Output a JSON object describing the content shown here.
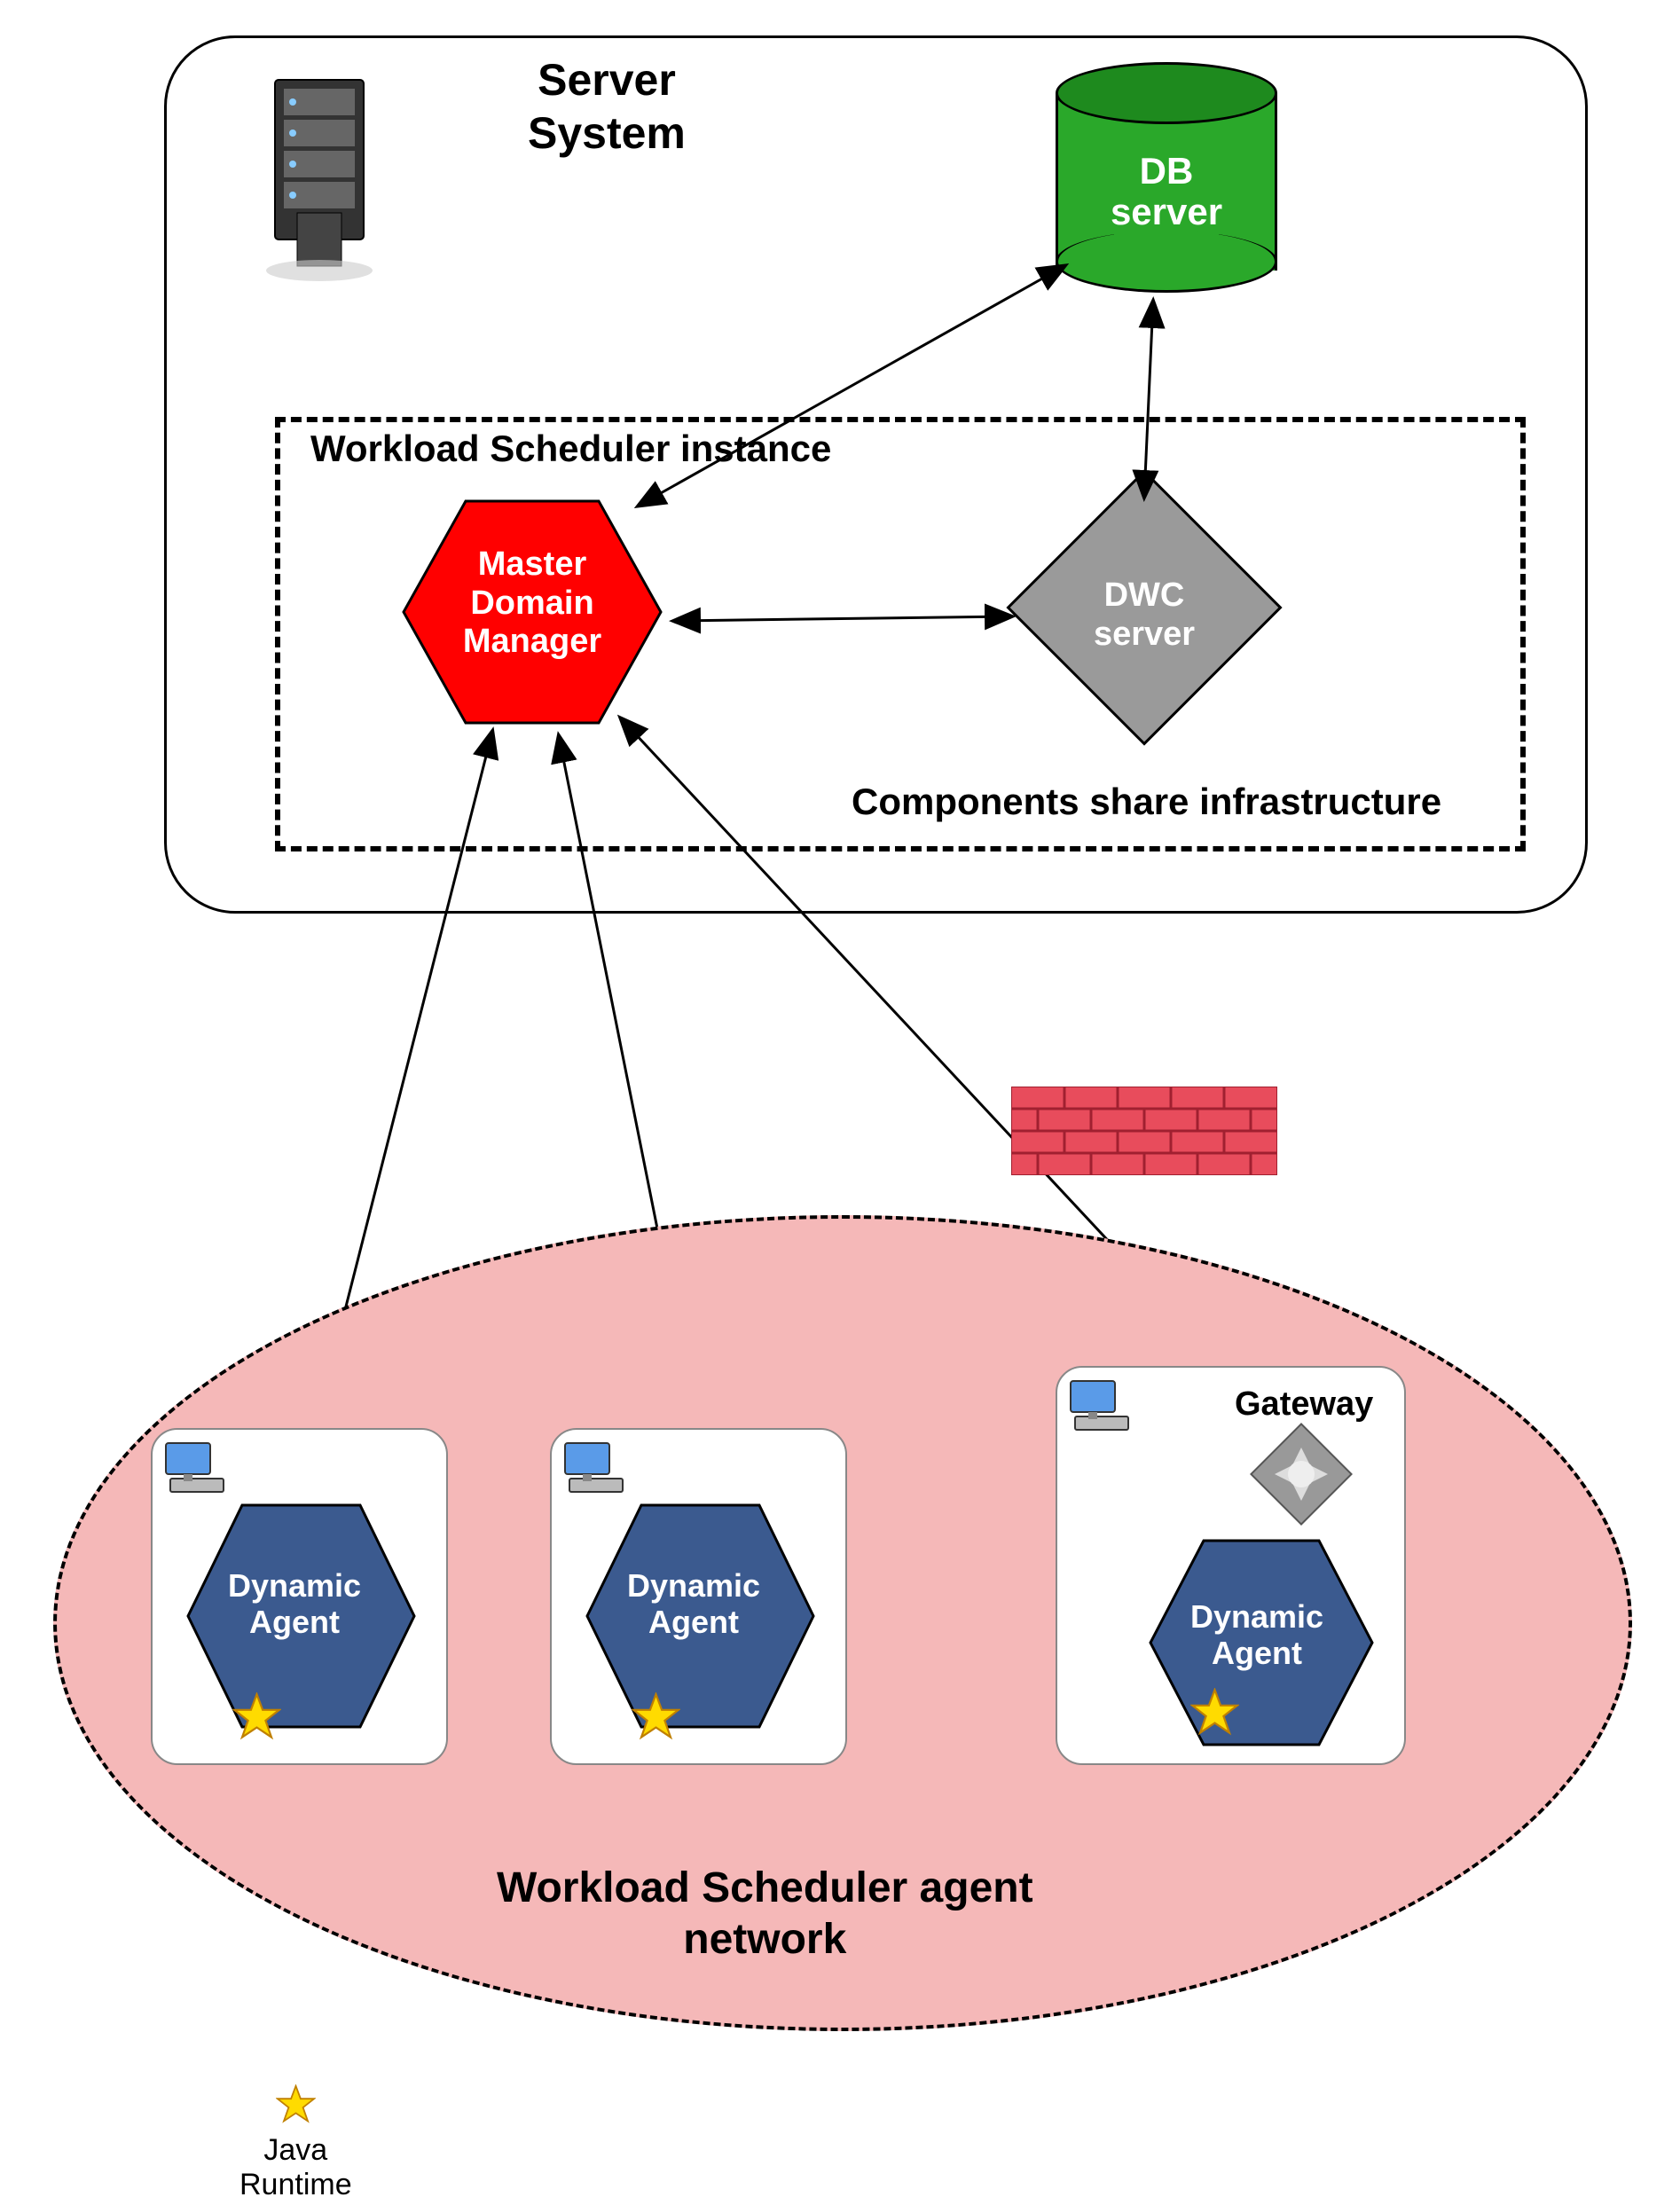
{
  "server": {
    "title_line1": "Server",
    "title_line2": "System"
  },
  "db": {
    "label_line1": "DB",
    "label_line2": "server"
  },
  "instance": {
    "title": "Workload Scheduler instance"
  },
  "mdm": {
    "line1": "Master",
    "line2": "Domain",
    "line3": "Manager"
  },
  "dwc": {
    "line1": "DWC",
    "line2": "server"
  },
  "components_text": "Components share infrastructure",
  "agent_network": {
    "title_line1": "Workload Scheduler agent",
    "title_line2": "network"
  },
  "gateway": {
    "label": "Gateway"
  },
  "agent": {
    "line1": "Dynamic",
    "line2": "Agent"
  },
  "legend": {
    "line1": "Java",
    "line2": "Runtime"
  }
}
